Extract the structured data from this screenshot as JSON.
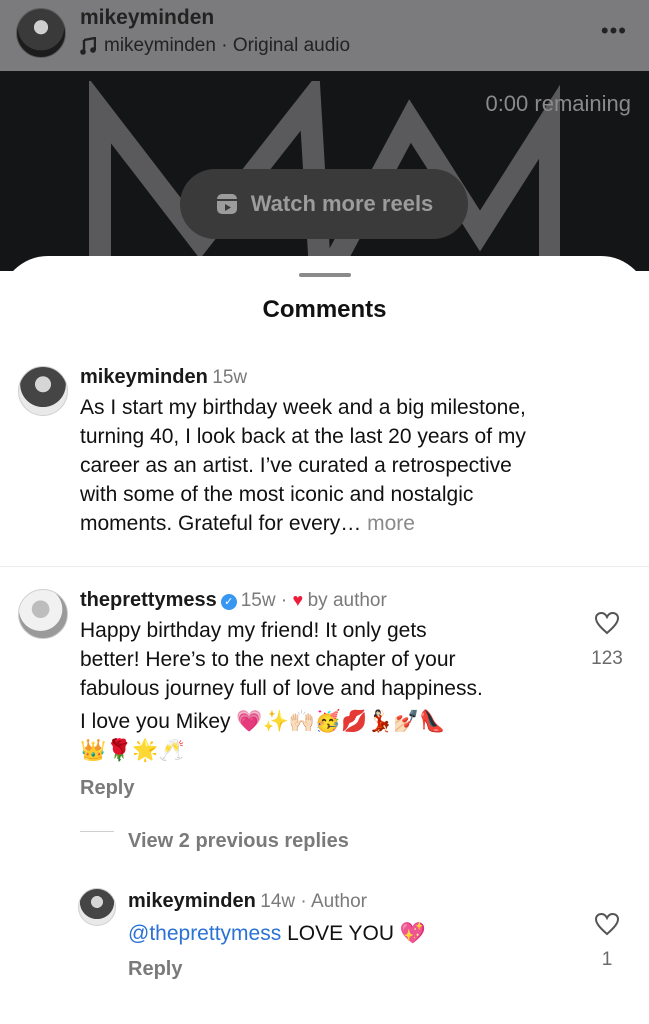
{
  "header": {
    "username": "mikeyminden",
    "audio": "mikeyminden · Original audio",
    "more_icon": "more-horizontal-icon"
  },
  "video": {
    "remaining": "0:00 remaining",
    "watch_more": "Watch more reels"
  },
  "sheet": {
    "title": "Comments"
  },
  "caption": {
    "username": "mikeyminden",
    "age": "15w",
    "lines": [
      "As I start my birthday week and a big milestone,",
      "turning 40, I look back at the last 20 years of my",
      "career as an artist. I’ve curated a retrospective",
      "with some of the most iconic and nostalgic",
      "moments. Grateful for every…"
    ],
    "more": "more"
  },
  "comment": {
    "username": "theprettymess",
    "age": "15w",
    "liked_by": "by author",
    "lines": [
      "Happy birthday my friend! It only gets",
      "better! Here’s to the next chapter of your",
      "fabulous journey full of  love and happiness.",
      "I love you Mikey 💗✨🙌🏻🥳💋💃🏻💅🏻👠",
      "👑🌹🌟🥂"
    ],
    "like_count": "123",
    "reply": "Reply",
    "view_replies": "View 2 previous replies"
  },
  "reply_comment": {
    "username": "mikeyminden",
    "age": "14w",
    "role": "Author",
    "mention": "@theprettymess",
    "text": "LOVE YOU 💖",
    "like_count": "1",
    "reply": "Reply"
  },
  "colors": {
    "accent_blue": "#3897f0",
    "heart_red": "#ed1c3a",
    "mention_blue": "#2a72d4"
  }
}
